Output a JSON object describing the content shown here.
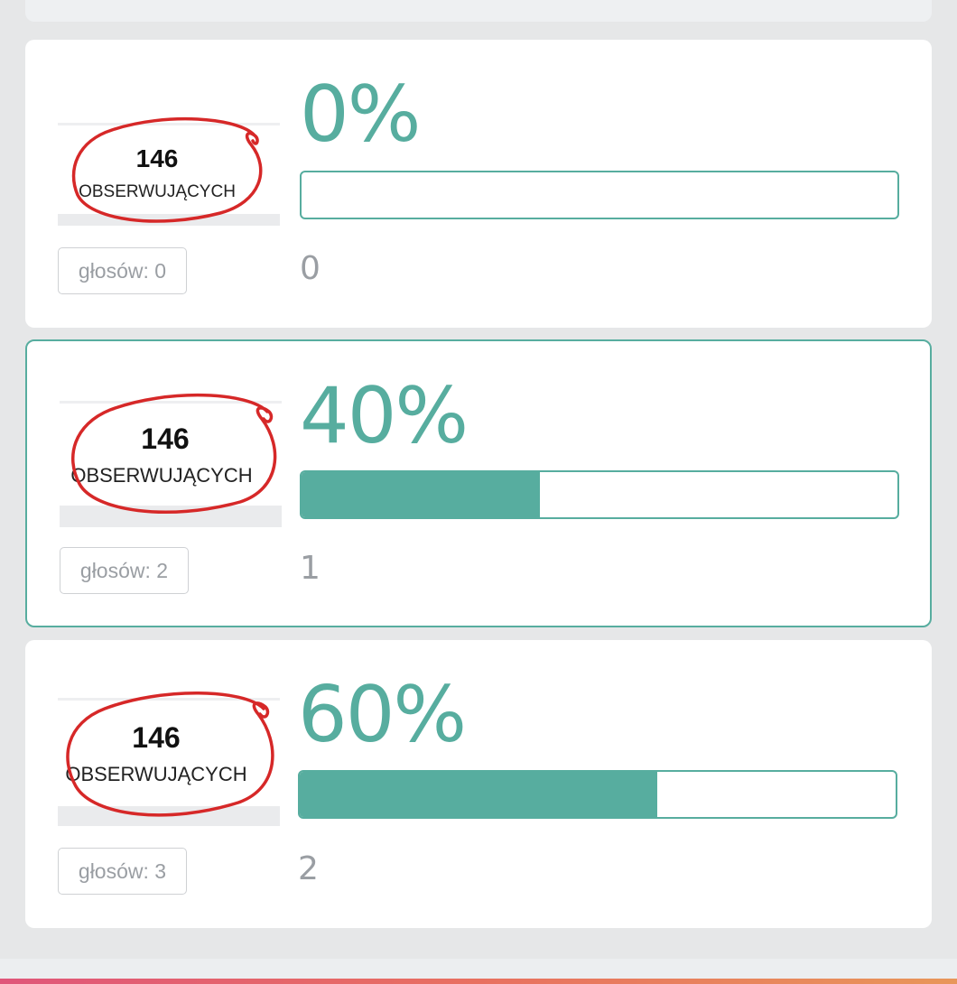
{
  "theme": {
    "accent": "#57ad9f",
    "circle_color": "#d62828",
    "muted_text": "#9a9ea3"
  },
  "options": [
    {
      "thumbnail": {
        "count": "146",
        "label": "OBSERWUJĄCYCH"
      },
      "votes_label": "głosów: 0",
      "percent_text": "0%",
      "percent_value": 0,
      "index": "0",
      "selected": false
    },
    {
      "thumbnail": {
        "count": "146",
        "label": "OBSERWUJĄCYCH"
      },
      "votes_label": "głosów: 2",
      "percent_text": "40%",
      "percent_value": 40,
      "index": "1",
      "selected": true
    },
    {
      "thumbnail": {
        "count": "146",
        "label": "OBSERWUJĄCYCH"
      },
      "votes_label": "głosów: 3",
      "percent_text": "60%",
      "percent_value": 60,
      "index": "2",
      "selected": false
    }
  ]
}
